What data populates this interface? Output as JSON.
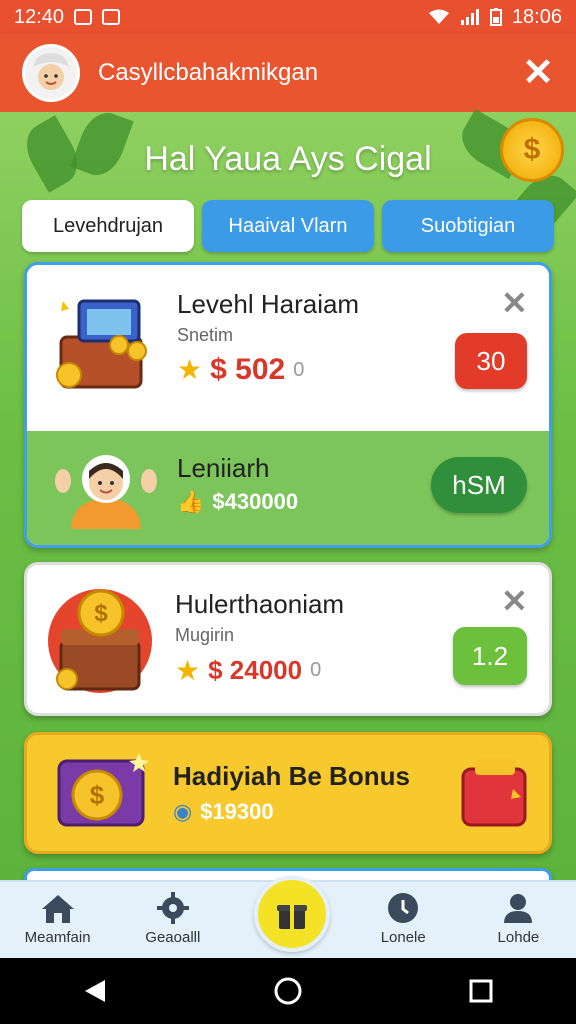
{
  "status_bar": {
    "time_left": "12:40",
    "time_right": "18:06"
  },
  "header": {
    "title": "Casyllcbahakmikgan"
  },
  "page": {
    "title": "Hal Yaua Ays Cigal"
  },
  "tabs": [
    {
      "label": "Levehdrujan",
      "active": true
    },
    {
      "label": "Haaival Vlarn",
      "active": false
    },
    {
      "label": "Suobtigian",
      "active": false
    }
  ],
  "items": [
    {
      "title": "Levehl Haraiam",
      "subtitle": "Snetim",
      "price": "$ 502",
      "price_extra": "0",
      "badge": "30",
      "badge_color": "#e23b2a"
    },
    {
      "title": "Leniiarh",
      "price": "$430000",
      "badge": "hSM",
      "badge_color": "#2f8f3a"
    },
    {
      "title": "Hulerthaoniam",
      "subtitle": "Mugirin",
      "price": "$ 24000",
      "price_extra": "0",
      "badge": "1.2",
      "badge_color": "#6cc13c"
    },
    {
      "title": "Hadiyiah Be Bonus",
      "price": "$19300"
    }
  ],
  "bottom_nav": [
    {
      "label": "Meamfain",
      "icon": "home-icon"
    },
    {
      "label": "Geaoalll",
      "icon": "gear-icon"
    },
    {
      "label": "Lonele",
      "icon": "clock-icon"
    },
    {
      "label": "Lohde",
      "icon": "profile-icon"
    }
  ],
  "colors": {
    "header": "#e8552e",
    "background": "#6cc04a",
    "tab_blue": "#3b9be6",
    "accent_yellow": "#f8c92c"
  }
}
